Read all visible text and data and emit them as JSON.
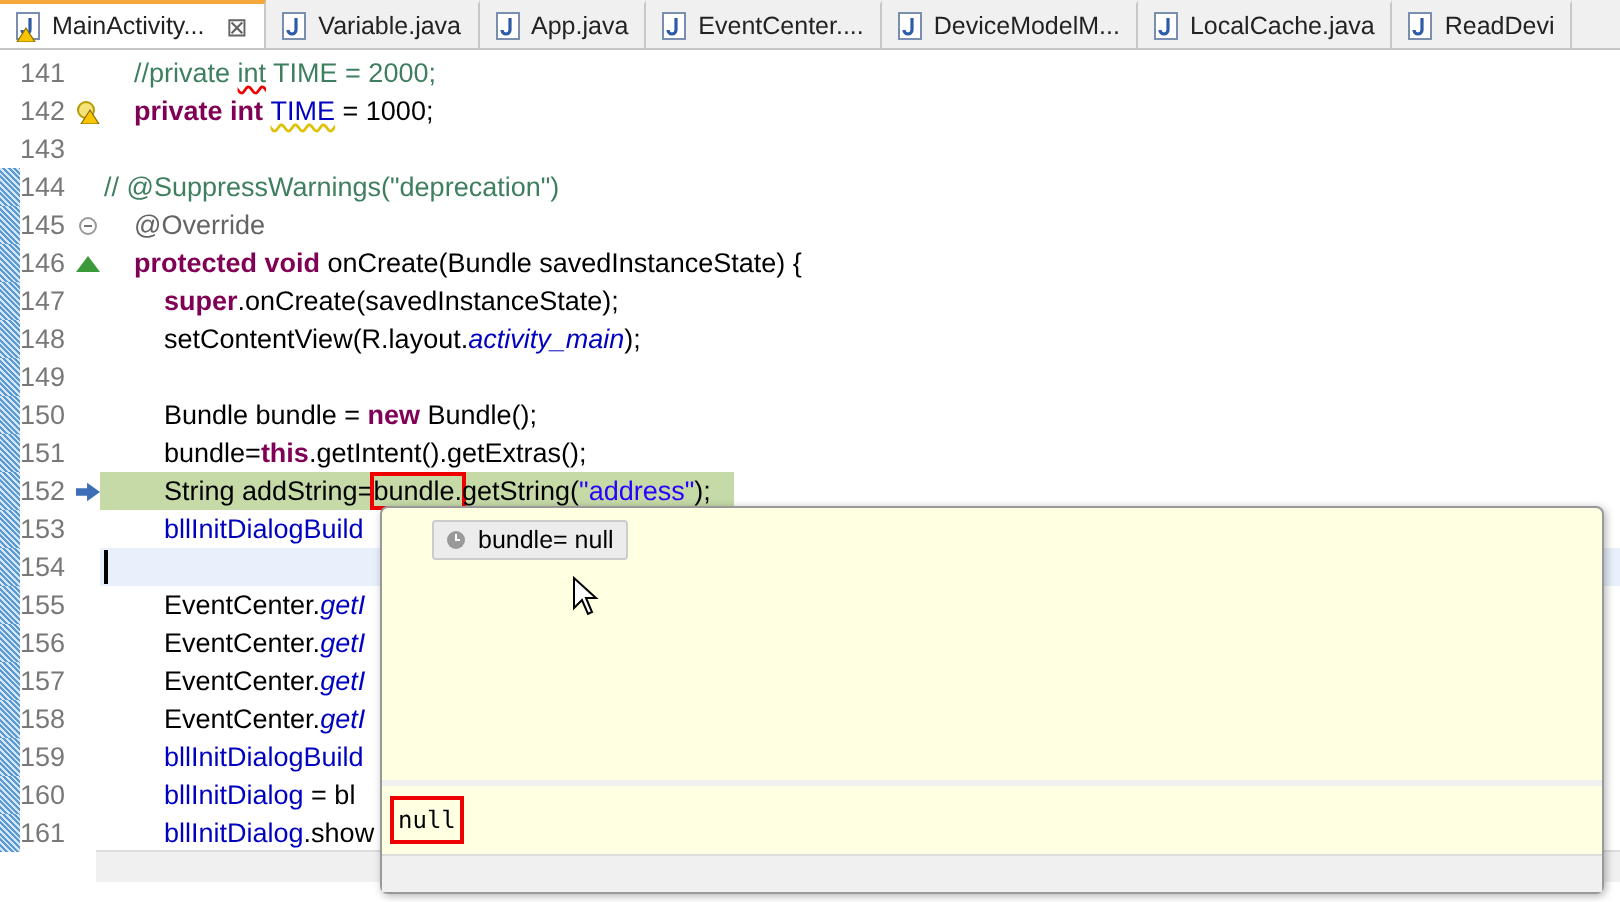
{
  "tabs": [
    {
      "label": "MainActivity...",
      "selected": true,
      "has_warning": true,
      "close": "⊠"
    },
    {
      "label": "Variable.java",
      "selected": false,
      "has_warning": false
    },
    {
      "label": "App.java",
      "selected": false,
      "has_warning": false
    },
    {
      "label": "EventCenter....",
      "selected": false,
      "has_warning": false
    },
    {
      "label": "DeviceModelM...",
      "selected": false,
      "has_warning": false
    },
    {
      "label": "LocalCache.java",
      "selected": false,
      "has_warning": false
    },
    {
      "label": "ReadDevi",
      "selected": false,
      "has_warning": false
    }
  ],
  "lines": [
    {
      "number": "141",
      "changed": false,
      "current_line": false,
      "cursor_line": false,
      "tokens": [
        {
          "text": "    //private ",
          "kind": "comment"
        },
        {
          "text": "int",
          "kind": "comment",
          "error_underline": true
        },
        {
          "text": " TIME = 2000;",
          "kind": "comment"
        }
      ]
    },
    {
      "number": "142",
      "changed": false,
      "current_line": false,
      "cursor_line": false,
      "marker": {
        "kind": "warning"
      },
      "tokens": [
        {
          "text": "    private int ",
          "kind": "keyword"
        },
        {
          "text": "TIME",
          "kind": "field",
          "warning_underline": true
        },
        {
          "text": " = 1000;",
          "kind": "plain"
        }
      ]
    },
    {
      "number": "143",
      "changed": false,
      "current_line": false,
      "cursor_line": false
    },
    {
      "number": "144",
      "changed": true,
      "current_line": false,
      "cursor_line": false,
      "tokens": [
        {
          "text": "// @SuppressWarnings(\"deprecation\")",
          "kind": "comment"
        }
      ]
    },
    {
      "number": "145",
      "changed": true,
      "current_line": false,
      "cursor_line": false,
      "marker": {
        "kind": "fold"
      },
      "tokens": [
        {
          "text": "    @Override",
          "kind": "annotation"
        }
      ]
    },
    {
      "number": "146",
      "changed": true,
      "current_line": false,
      "cursor_line": false,
      "marker": {
        "kind": "override"
      },
      "tokens": [
        {
          "text": "    protected void ",
          "kind": "keyword"
        },
        {
          "text": "onCreate(Bundle savedInstanceState) {",
          "kind": "plain"
        }
      ]
    },
    {
      "number": "147",
      "changed": true,
      "current_line": false,
      "cursor_line": false,
      "tokens": [
        {
          "text": "        super",
          "kind": "keyword"
        },
        {
          "text": ".onCreate(savedInstanceState);",
          "kind": "plain"
        }
      ]
    },
    {
      "number": "148",
      "changed": true,
      "current_line": false,
      "cursor_line": false,
      "tokens": [
        {
          "text": "        setContentView(R.layout.",
          "kind": "plain"
        },
        {
          "text": "activity_main",
          "kind": "static"
        },
        {
          "text": ");",
          "kind": "plain"
        }
      ]
    },
    {
      "number": "149",
      "changed": true,
      "current_line": false,
      "cursor_line": false
    },
    {
      "number": "150",
      "changed": true,
      "current_line": false,
      "cursor_line": false,
      "tokens": [
        {
          "text": "        Bundle bundle = ",
          "kind": "plain"
        },
        {
          "text": "new",
          "kind": "keyword"
        },
        {
          "text": " Bundle();",
          "kind": "plain"
        }
      ]
    },
    {
      "number": "151",
      "changed": true,
      "current_line": false,
      "cursor_line": false,
      "tokens": [
        {
          "text": "        bundle=",
          "kind": "plain"
        },
        {
          "text": "this",
          "kind": "keyword"
        },
        {
          "text": ".getIntent().getExtras();",
          "kind": "plain"
        }
      ]
    },
    {
      "number": "152",
      "changed": true,
      "current_line": true,
      "cursor_line": false,
      "marker": {
        "kind": "debug"
      },
      "tokens": [
        {
          "text": "        String addString=",
          "kind": "plain"
        },
        {
          "text": "bundle.",
          "kind": "plain",
          "boxed": true
        },
        {
          "text": "getString(",
          "kind": "plain"
        },
        {
          "text": "\"address\"",
          "kind": "string"
        },
        {
          "text": ");",
          "kind": "plain"
        }
      ]
    },
    {
      "number": "153",
      "changed": true,
      "current_line": false,
      "cursor_line": false,
      "tokens": [
        {
          "text": "        bllInitDialogBuild",
          "kind": "field"
        }
      ]
    },
    {
      "number": "154",
      "changed": true,
      "current_line": false,
      "cursor_line": true
    },
    {
      "number": "155",
      "changed": true,
      "current_line": false,
      "cursor_line": false,
      "tokens": [
        {
          "text": "        EventCenter.",
          "kind": "plain"
        },
        {
          "text": "getI",
          "kind": "static"
        }
      ]
    },
    {
      "number": "156",
      "changed": true,
      "current_line": false,
      "cursor_line": false,
      "tokens": [
        {
          "text": "        EventCenter.",
          "kind": "plain"
        },
        {
          "text": "getI",
          "kind": "static"
        }
      ]
    },
    {
      "number": "157",
      "changed": true,
      "current_line": false,
      "cursor_line": false,
      "tokens": [
        {
          "text": "        EventCenter.",
          "kind": "plain"
        },
        {
          "text": "getI",
          "kind": "static"
        }
      ]
    },
    {
      "number": "158",
      "changed": true,
      "current_line": false,
      "cursor_line": false,
      "tokens": [
        {
          "text": "        EventCenter.",
          "kind": "plain"
        },
        {
          "text": "getI",
          "kind": "static"
        }
      ]
    },
    {
      "number": "159",
      "changed": true,
      "current_line": false,
      "cursor_line": false,
      "tokens": [
        {
          "text": "        bllInitDialogBuild",
          "kind": "field"
        }
      ]
    },
    {
      "number": "160",
      "changed": true,
      "current_line": false,
      "cursor_line": false,
      "tokens": [
        {
          "text": "        bllInitDialog",
          "kind": "field"
        },
        {
          "text": " = bl",
          "kind": "plain"
        }
      ]
    },
    {
      "number": "161",
      "changed": true,
      "current_line": false,
      "cursor_line": false,
      "tokens": [
        {
          "text": "        bllInitDialog",
          "kind": "field"
        },
        {
          "text": ".show",
          "kind": "plain"
        }
      ]
    }
  ],
  "inspect_popup": {
    "variable": "bundle= null",
    "value": "null",
    "value_boxed": true
  }
}
